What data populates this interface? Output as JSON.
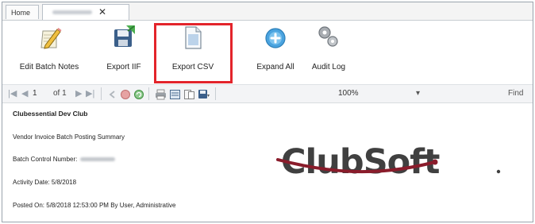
{
  "tabs": {
    "home_label": "Home",
    "close_glyph": "✕"
  },
  "toolbar": {
    "edit_batch_notes": "Edit Batch Notes",
    "export_iif": "Export IIF",
    "export_csv": "Export CSV",
    "expand_all": "Expand All",
    "audit_log": "Audit Log"
  },
  "navbar": {
    "first": "|◀",
    "prev": "◀",
    "current_page": "1",
    "of_pages": "of 1",
    "next": "▶",
    "last": "▶|",
    "zoom": "100%",
    "zoom_caret": "▾",
    "find": "Find"
  },
  "report": {
    "club_name": "Clubessential Dev Club",
    "summary_title": "Vendor Invoice Batch Posting Summary",
    "batch_control_label": "Batch Control Number:",
    "activity_date": "Activity Date: 5/8/2018",
    "posted_on": "Posted On: 5/8/2018 12:53:00 PM By User, Administrative"
  },
  "logo": {
    "text": "ClubSoft",
    "accent_color": "#8a1c2b"
  },
  "colors": {
    "highlight": "#e3242b",
    "icon_blue": "#4aa3df",
    "icon_green": "#4caf50"
  }
}
